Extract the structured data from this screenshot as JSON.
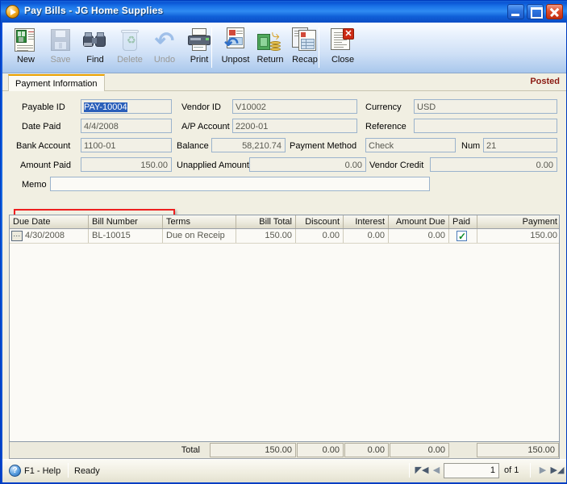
{
  "window": {
    "title": "Pay Bills - JG Home Supplies",
    "app_icon": "play-circle-icon",
    "minimize_label": "",
    "maximize_label": "",
    "close_label": ""
  },
  "toolbar": {
    "buttons": [
      {
        "label": "New",
        "icon": "new-document-icon",
        "enabled": true
      },
      {
        "label": "Save",
        "icon": "floppy-disk-icon",
        "enabled": false
      },
      {
        "label": "Find",
        "icon": "binoculars-icon",
        "enabled": true
      },
      {
        "label": "Delete",
        "icon": "recycle-bin-icon",
        "enabled": false
      },
      {
        "label": "Undo",
        "icon": "undo-arrow-icon",
        "enabled": false
      },
      {
        "label": "Print",
        "icon": "printer-icon",
        "enabled": true
      },
      {
        "label": "Unpost",
        "icon": "unpost-icon",
        "enabled": true
      },
      {
        "label": "Return",
        "icon": "return-money-icon",
        "enabled": true
      },
      {
        "label": "Recap",
        "icon": "recap-report-icon",
        "enabled": true
      },
      {
        "label": "Close",
        "icon": "close-document-icon",
        "enabled": true
      }
    ]
  },
  "tabs": [
    {
      "label": "Payment Information",
      "active": true
    }
  ],
  "status_flag": "Posted",
  "form": {
    "payable_id": {
      "label": "Payable ID",
      "value": "PAY-10004",
      "selected": true
    },
    "date_paid": {
      "label": "Date Paid",
      "value": "4/4/2008",
      "highlighted": true
    },
    "bank_account": {
      "label": "Bank Account",
      "value": "1100-01"
    },
    "amount_paid": {
      "label": "Amount Paid",
      "value": "150.00"
    },
    "memo": {
      "label": "Memo",
      "value": ""
    },
    "vendor_id": {
      "label": "Vendor ID",
      "value": "V10002"
    },
    "ap_account": {
      "label": "A/P Account",
      "value": "2200-01"
    },
    "balance": {
      "label": "Balance",
      "value": "58,210.74"
    },
    "unapplied_amount": {
      "label": "Unapplied Amount",
      "value": "0.00"
    },
    "currency": {
      "label": "Currency",
      "value": "USD"
    },
    "reference": {
      "label": "Reference",
      "value": ""
    },
    "payment_method": {
      "label": "Payment Method",
      "value": "Check"
    },
    "num": {
      "label": "Num",
      "value": "21"
    },
    "vendor_credit": {
      "label": "Vendor Credit",
      "value": "0.00"
    }
  },
  "grid": {
    "columns": [
      {
        "key": "due_date",
        "label": "Due Date",
        "align": "left"
      },
      {
        "key": "bill_number",
        "label": "Bill Number",
        "align": "left"
      },
      {
        "key": "terms",
        "label": "Terms",
        "align": "left"
      },
      {
        "key": "bill_total",
        "label": "Bill Total",
        "align": "right"
      },
      {
        "key": "discount",
        "label": "Discount",
        "align": "right"
      },
      {
        "key": "interest",
        "label": "Interest",
        "align": "right"
      },
      {
        "key": "amount_due",
        "label": "Amount Due",
        "align": "right"
      },
      {
        "key": "paid",
        "label": "Paid",
        "align": "center"
      },
      {
        "key": "payment",
        "label": "Payment",
        "align": "right"
      }
    ],
    "rows": [
      {
        "lookup": "...",
        "due_date": "4/30/2008",
        "bill_number": "BL-10015",
        "terms": "Due on Receip",
        "bill_total": "150.00",
        "discount": "0.00",
        "interest": "0.00",
        "amount_due": "0.00",
        "paid": true,
        "payment": "150.00"
      }
    ],
    "totals": {
      "label": "Total",
      "bill_total": "150.00",
      "discount": "0.00",
      "interest": "0.00",
      "amount_due": "0.00",
      "payment": "150.00"
    }
  },
  "statusbar": {
    "help_icon": "question-mark-icon",
    "help_label": "F1 - Help",
    "state": "Ready",
    "nav": {
      "first_icon": "first-record-icon",
      "prev_icon": "previous-record-icon",
      "current": "1",
      "of_text": "of  1",
      "next_icon": "next-record-icon",
      "last_icon": "last-record-icon"
    }
  },
  "colors": {
    "titlebar_blue": "#1767e0",
    "posted_red": "#8b1a12",
    "annotation_red": "#ee1f1f",
    "tab_accent": "#e8a000",
    "panel_beige": "#f1efe2",
    "field_border": "#9bb3cc",
    "check_green": "#0a8a26"
  }
}
